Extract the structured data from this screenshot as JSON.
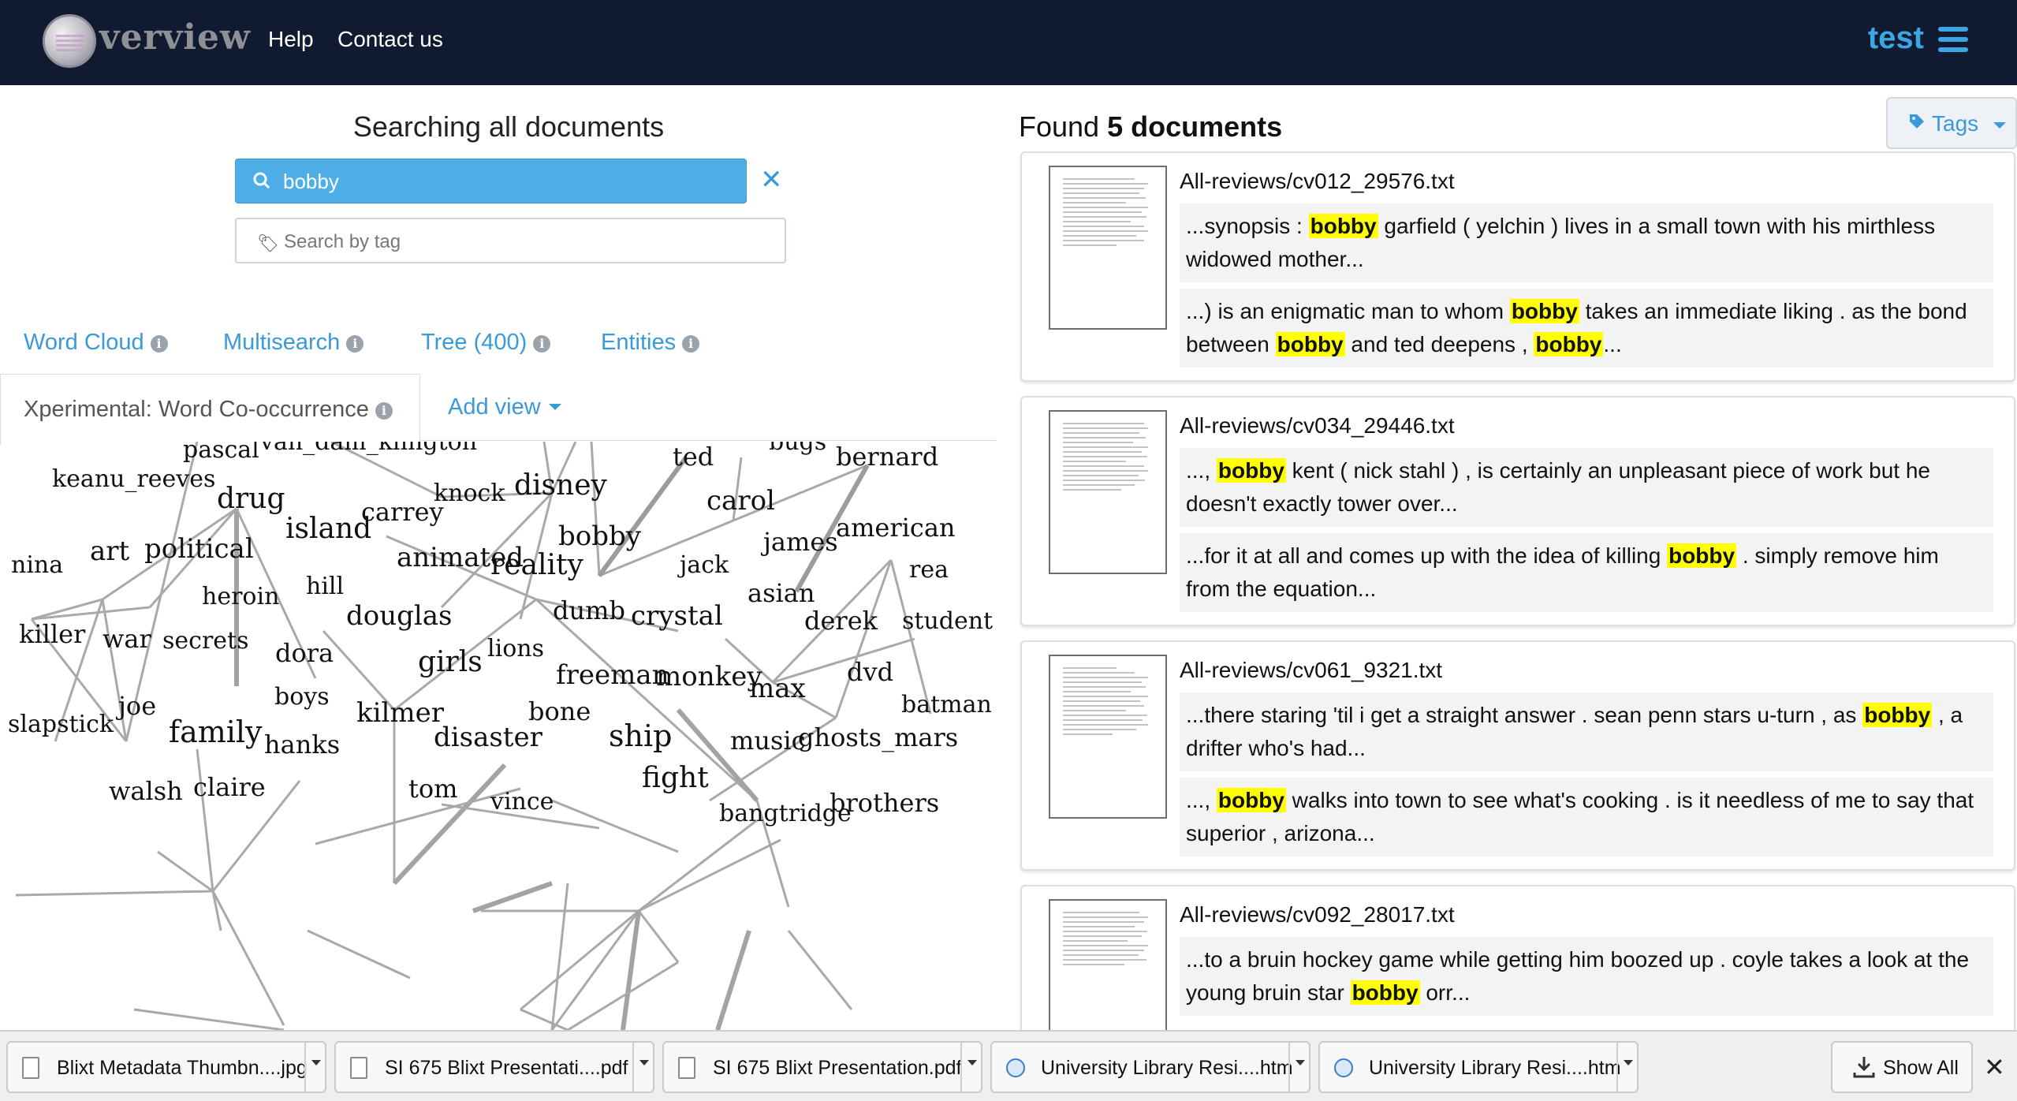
{
  "navbar": {
    "logo_text": "verview",
    "help": "Help",
    "contact": "Contact us",
    "user": "test"
  },
  "search": {
    "heading": "Searching all documents",
    "query": "bobby",
    "tag_placeholder": "Search by tag"
  },
  "views": {
    "tabs": [
      "Word Cloud",
      "Multisearch",
      "Tree (400)",
      "Entities"
    ],
    "active": "Xperimental: Word Co-occurrence",
    "add_view": "Add view"
  },
  "cooccurrence": {
    "words": [
      "pascal",
      "van_dam_klington",
      "ted",
      "bugs",
      "bernard",
      "keanu_reeves",
      "knock",
      "disney",
      "drug",
      "carol",
      "carrey",
      "island",
      "american",
      "bobby",
      "james",
      "art",
      "political",
      "nina",
      "animated",
      "reality",
      "jack",
      "rea",
      "hill",
      "asian",
      "heroin",
      "douglas",
      "dumb",
      "crystal",
      "derek",
      "student",
      "killer",
      "war",
      "secrets",
      "dora",
      "lions",
      "girls",
      "freeman",
      "monkey",
      "dvd",
      "max",
      "boys",
      "batman",
      "joe",
      "kilmer",
      "bone",
      "slapstick",
      "family",
      "hanks",
      "disaster",
      "ship",
      "music",
      "ghosts_mars",
      "fight",
      "walsh",
      "claire",
      "tom",
      "vince",
      "brothers",
      "bangtridge"
    ]
  },
  "results": {
    "found_prefix": "Found",
    "found_count": "5 documents",
    "tags_button": "Tags",
    "documents": [
      {
        "title": "All-reviews/cv012_29576.txt",
        "snippets": [
          {
            "before": "...synopsis : ",
            "hit": "bobby",
            "after": " garfield ( yelchin ) lives in a small town with his mirthless widowed mother..."
          },
          {
            "before": "...) is an enigmatic man to whom ",
            "hit": "bobby",
            "mid": " takes an immediate liking . as the bond between ",
            "hit2": "bobby",
            "mid2": " and ted deepens , ",
            "hit3": "bobby",
            "after": "..."
          }
        ]
      },
      {
        "title": "All-reviews/cv034_29446.txt",
        "snippets": [
          {
            "before": "..., ",
            "hit": "bobby",
            "after": " kent ( nick stahl ) , is certainly an unpleasant piece of work but he doesn't exactly tower over..."
          },
          {
            "before": "...for it at all and comes up with the idea of killing ",
            "hit": "bobby",
            "after": " . simply remove him from the equation..."
          }
        ]
      },
      {
        "title": "All-reviews/cv061_9321.txt",
        "snippets": [
          {
            "before": "...there staring 'til i get a straight answer . sean penn stars u-turn , as ",
            "hit": "bobby",
            "after": " , a drifter who's had..."
          },
          {
            "before": "..., ",
            "hit": "bobby",
            "after": " walks into town to see what's cooking . is it needless of me to say that superior , arizona..."
          }
        ]
      },
      {
        "title": "All-reviews/cv092_28017.txt",
        "snippets": [
          {
            "before": "...to a bruin hockey game while getting him boozed up . coyle takes a look at the young bruin star ",
            "hit": "bobby",
            "after": " orr..."
          }
        ]
      }
    ]
  },
  "downloads": {
    "items": [
      "Blixt Metadata Thumbn....jpg",
      "SI 675 Blixt Presentati....pdf",
      "SI 675 Blixt Presentation.pdf",
      "University Library Resi....htm",
      "University Library Resi....htm"
    ],
    "show_all": "Show All"
  },
  "colors": {
    "navbar_bg": "#101b31",
    "accent": "#3a9ad9",
    "search_bg": "#4eaee8",
    "highlight": "#ffff00"
  }
}
